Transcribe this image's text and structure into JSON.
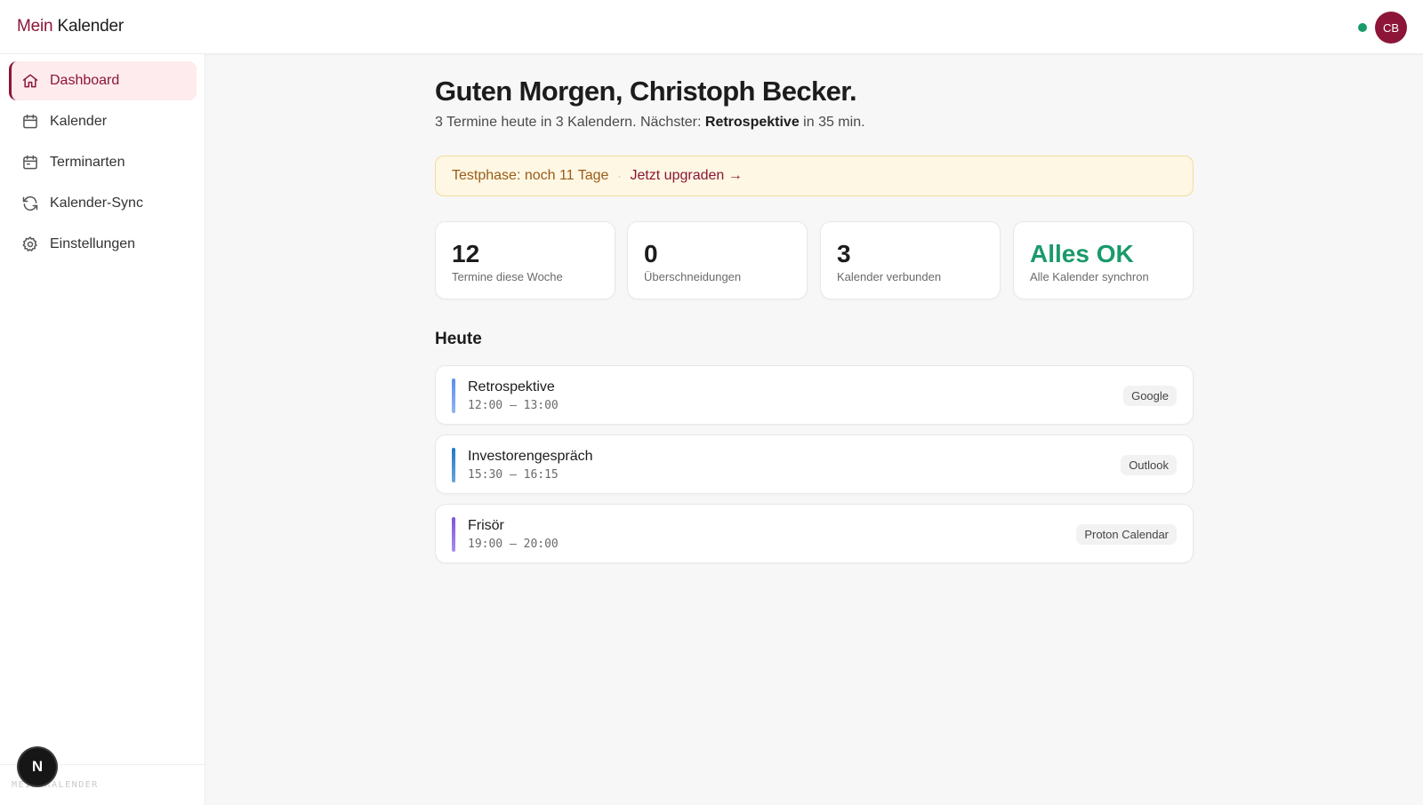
{
  "header": {
    "brand_part1": "Mein",
    "brand_part2": "Kalender",
    "avatar_initials": "CB",
    "status_color": "#1a9a6b"
  },
  "sidebar": {
    "items": [
      {
        "label": "Dashboard",
        "icon": "home-icon",
        "active": true
      },
      {
        "label": "Kalender",
        "icon": "calendar-icon",
        "active": false
      },
      {
        "label": "Terminarten",
        "icon": "calendar-icon",
        "active": false
      },
      {
        "label": "Kalender-Sync",
        "icon": "sync-icon",
        "active": false
      },
      {
        "label": "Einstellungen",
        "icon": "gear-icon",
        "active": false
      }
    ],
    "footer_text": "MEIN KALENDER",
    "badge_letter": "N"
  },
  "main": {
    "greeting": "Guten Morgen, Christoph Becker.",
    "subline_prefix": "3 Termine heute in 3 Kalendern. Nächster: ",
    "subline_next": "Retrospektive",
    "subline_suffix": " in 35 min.",
    "trial_text": "Testphase: noch 11 Tage",
    "trial_separator": "·",
    "trial_link": "Jetzt upgraden →",
    "stats": [
      {
        "value": "12",
        "label": "Termine diese Woche"
      },
      {
        "value": "0",
        "label": "Überschneidungen"
      },
      {
        "value": "3",
        "label": "Kalender verbunden"
      },
      {
        "value": "Alles OK",
        "label": "Alle Kalender synchron"
      }
    ],
    "today_title": "Heute",
    "events": [
      {
        "title": "Retrospektive",
        "time": "12:00 – 13:00",
        "source": "Google",
        "color": "#5b8def"
      },
      {
        "title": "Investorengespräch",
        "time": "15:30 – 16:15",
        "source": "Outlook",
        "color": "#1f78c8"
      },
      {
        "title": "Frisör",
        "time": "19:00 – 20:00",
        "source": "Proton Calendar",
        "color": "#7b55e0"
      }
    ]
  },
  "colors": {
    "accent": "#8c1538",
    "success": "#1a9a6b",
    "trial_bg": "#fdf7e3"
  }
}
